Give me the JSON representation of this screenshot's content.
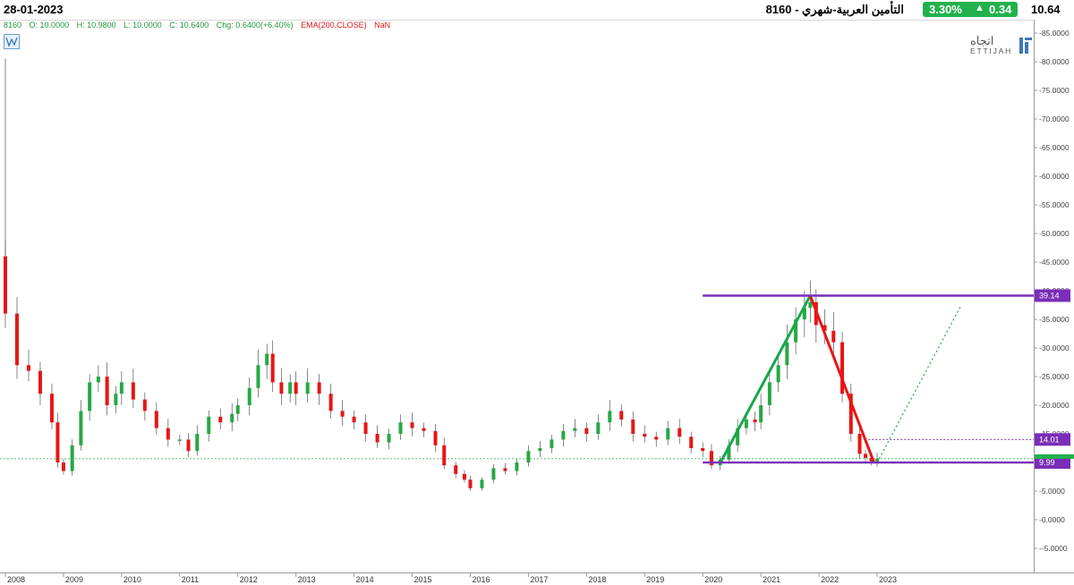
{
  "header": {
    "date": "28-01-2023",
    "title": "التأمين العربية-شهري  -  8160",
    "change_pct": "3.30%",
    "change_abs": "0.34",
    "last_price": "10.64"
  },
  "legend": {
    "symbol": "8160",
    "open": "O: 10.0000",
    "high": "H: 10.9800",
    "low": "L: 10.0000",
    "close": "C: 10.6400",
    "change": "Chg: 0.6400(+6.40%)",
    "indicator": "EMA(200,CLOSE)",
    "indicator_value": "NaN"
  },
  "brand": {
    "arabic": "اتجاه",
    "latin": "ETTIJAH"
  },
  "colors": {
    "up": "#27a844",
    "down": "#e81515",
    "trend_up": "#16a84a",
    "trend_down": "#e81515",
    "level": "#7a2db8",
    "accent": "#22b14c"
  },
  "chart_data": {
    "type": "candlestick",
    "interval": "monthly",
    "ylim": [
      -7,
      87
    ],
    "y_ticks": [
      -5,
      0,
      5,
      10,
      15,
      20,
      25,
      30,
      35,
      40,
      45,
      50,
      55,
      60,
      65,
      70,
      75,
      80,
      85
    ],
    "x_ticks": [
      "2008",
      "2009",
      "2010",
      "2011",
      "2012",
      "2013",
      "2014",
      "2015",
      "2016",
      "2017",
      "2018",
      "2019",
      "2020",
      "2021",
      "2022",
      "2023"
    ],
    "series_close": [
      [
        2008.0,
        36.0
      ],
      [
        2008.2,
        27.0
      ],
      [
        2008.4,
        26.0
      ],
      [
        2008.6,
        22.0
      ],
      [
        2008.8,
        17.0
      ],
      [
        2008.9,
        10.0
      ],
      [
        2009.0,
        8.5
      ],
      [
        2009.15,
        13.0
      ],
      [
        2009.3,
        19.0
      ],
      [
        2009.45,
        24.0
      ],
      [
        2009.6,
        25.0
      ],
      [
        2009.75,
        20.0
      ],
      [
        2009.9,
        22.0
      ],
      [
        2010.0,
        24.0
      ],
      [
        2010.2,
        21.0
      ],
      [
        2010.4,
        19.0
      ],
      [
        2010.6,
        16.0
      ],
      [
        2010.8,
        14.0
      ],
      [
        2011.0,
        14.0
      ],
      [
        2011.15,
        12.0
      ],
      [
        2011.3,
        15.0
      ],
      [
        2011.5,
        18.0
      ],
      [
        2011.7,
        17.0
      ],
      [
        2011.9,
        18.5
      ],
      [
        2012.0,
        20.0
      ],
      [
        2012.2,
        23.0
      ],
      [
        2012.35,
        27.0
      ],
      [
        2012.5,
        29.0
      ],
      [
        2012.6,
        24.0
      ],
      [
        2012.75,
        22.0
      ],
      [
        2012.9,
        24.0
      ],
      [
        2013.0,
        22.0
      ],
      [
        2013.2,
        24.0
      ],
      [
        2013.4,
        22.0
      ],
      [
        2013.6,
        19.0
      ],
      [
        2013.8,
        18.0
      ],
      [
        2014.0,
        17.0
      ],
      [
        2014.2,
        15.0
      ],
      [
        2014.4,
        13.5
      ],
      [
        2014.6,
        15.0
      ],
      [
        2014.8,
        17.0
      ],
      [
        2015.0,
        16.0
      ],
      [
        2015.2,
        15.5
      ],
      [
        2015.4,
        13.0
      ],
      [
        2015.55,
        9.5
      ],
      [
        2015.75,
        8.0
      ],
      [
        2015.9,
        7.0
      ],
      [
        2016.0,
        5.5
      ],
      [
        2016.2,
        7.0
      ],
      [
        2016.4,
        9.0
      ],
      [
        2016.6,
        8.5
      ],
      [
        2016.8,
        10.0
      ],
      [
        2017.0,
        12.0
      ],
      [
        2017.2,
        12.5
      ],
      [
        2017.4,
        14.0
      ],
      [
        2017.6,
        15.5
      ],
      [
        2017.8,
        16.0
      ],
      [
        2018.0,
        15.0
      ],
      [
        2018.2,
        17.0
      ],
      [
        2018.4,
        19.0
      ],
      [
        2018.6,
        17.5
      ],
      [
        2018.8,
        15.0
      ],
      [
        2019.0,
        14.5
      ],
      [
        2019.2,
        14.0
      ],
      [
        2019.4,
        16.0
      ],
      [
        2019.6,
        14.5
      ],
      [
        2019.8,
        12.5
      ],
      [
        2020.0,
        12.0
      ],
      [
        2020.15,
        9.5
      ],
      [
        2020.3,
        10.5
      ],
      [
        2020.45,
        13.0
      ],
      [
        2020.6,
        16.0
      ],
      [
        2020.75,
        17.5
      ],
      [
        2020.9,
        17.0
      ],
      [
        2021.0,
        20.0
      ],
      [
        2021.15,
        24.0
      ],
      [
        2021.3,
        27.0
      ],
      [
        2021.45,
        31.0
      ],
      [
        2021.6,
        35.0
      ],
      [
        2021.75,
        37.0
      ],
      [
        2021.85,
        38.0
      ],
      [
        2021.95,
        34.0
      ],
      [
        2022.1,
        33.0
      ],
      [
        2022.25,
        31.0
      ],
      [
        2022.4,
        22.0
      ],
      [
        2022.55,
        15.0
      ],
      [
        2022.7,
        11.5
      ],
      [
        2022.8,
        10.8
      ],
      [
        2022.9,
        10.2
      ],
      [
        2023.0,
        10.64
      ]
    ],
    "trend_lines": [
      {
        "style": "solid",
        "color": "up",
        "from": [
          2020.3,
          9.9
        ],
        "to": [
          2021.85,
          39.14
        ]
      },
      {
        "style": "solid",
        "color": "down",
        "from": [
          2021.85,
          39.14
        ],
        "to": [
          2022.95,
          9.9
        ]
      },
      {
        "style": "dotted",
        "color": "up",
        "from": [
          2023.0,
          9.99
        ],
        "to": [
          2024.45,
          37.5
        ]
      }
    ],
    "levels": [
      {
        "value": 39.14,
        "label": "39.14",
        "style": "solid"
      },
      {
        "value": 14.01,
        "label": "14.01",
        "style": "dotted"
      },
      {
        "value": 9.99,
        "label": "9.99",
        "style": "solid"
      }
    ],
    "current_price": 10.64
  }
}
